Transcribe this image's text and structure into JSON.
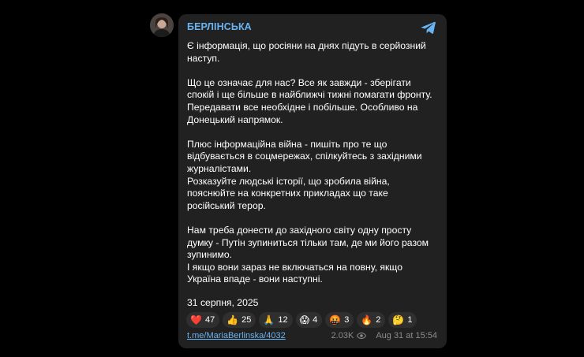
{
  "channel": {
    "name": "БЕРЛІНСЬКА"
  },
  "message": {
    "paragraphs": [
      [
        "Є інформація, що росіяни на днях підуть в серйозний",
        "наступ."
      ],
      [
        "Що це означає для нас? Все як завжди - зберігати",
        "спокій і ще більше в найближчі тижні помагати фронту.",
        "Передавати все необхідне і побільше. Особливо на",
        "Донецький напрямок."
      ],
      [
        "Плюс інформаційна війна - пишіть про те що",
        "відбувається в соцмережах, спілкуйтесь з західними",
        "журналістами.",
        "Розказуйте людські історії, що зробила війна,",
        "пояснюйте на конкретних прикладах що таке",
        "російський терор."
      ],
      [
        "Нам треба донести до західного світу одну просту",
        "думку - Путін зупиниться тільки там, де ми його разом",
        "зупинимо.",
        "І якщо вони зараз не включаться на повну, якщо",
        "Україна впаде - вони наступні."
      ]
    ],
    "date_line": "31 серпня, 2025"
  },
  "reactions": [
    {
      "icon": "red-heart",
      "emoji": "❤️",
      "count": "47"
    },
    {
      "icon": "thumbs-up",
      "emoji": "👍",
      "count": "25"
    },
    {
      "icon": "folded-hands",
      "emoji": "🙏",
      "count": "12"
    },
    {
      "icon": "screaming-face",
      "emoji": "😱",
      "count": "4"
    },
    {
      "icon": "angry-face",
      "emoji": "🤬",
      "count": "3"
    },
    {
      "icon": "fire",
      "emoji": "🔥",
      "count": "2"
    },
    {
      "icon": "thinking-face",
      "emoji": "🤔",
      "count": "1"
    }
  ],
  "footer": {
    "link": "t.me/MariaBerlinska/4032",
    "views": "2.03K",
    "time": "Aug 31 at 15:54"
  },
  "colors": {
    "background": "#000000",
    "card": "#212121",
    "accent": "#6ab3f3",
    "text": "#ffffff",
    "muted": "#8b8b8b"
  }
}
